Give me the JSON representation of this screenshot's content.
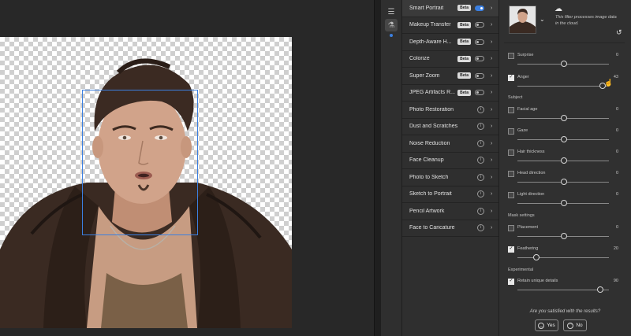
{
  "filters": [
    {
      "label": "Smart Portrait",
      "badge": "Beta",
      "control": "toggle",
      "on": true,
      "active": true
    },
    {
      "label": "Makeup Transfer",
      "badge": "Beta",
      "control": "toggle",
      "on": false
    },
    {
      "label": "Depth-Aware H...",
      "badge": "Beta",
      "control": "toggle",
      "on": false
    },
    {
      "label": "Colorize",
      "badge": "Beta",
      "control": "toggle",
      "on": false
    },
    {
      "label": "Super Zoom",
      "badge": "Beta",
      "control": "toggle",
      "on": false
    },
    {
      "label": "JPEG Artifacts R...",
      "badge": "Beta",
      "control": "toggle",
      "on": false
    },
    {
      "label": "Photo Restoration",
      "control": "info"
    },
    {
      "label": "Dust and Scratches",
      "control": "info"
    },
    {
      "label": "Noise Reduction",
      "control": "info"
    },
    {
      "label": "Face Cleanup",
      "control": "info"
    },
    {
      "label": "Photo to Sketch",
      "control": "info"
    },
    {
      "label": "Sketch to Portrait",
      "control": "info"
    },
    {
      "label": "Pencil Artwork",
      "control": "info"
    },
    {
      "label": "Face to Caricature",
      "control": "info"
    }
  ],
  "header": {
    "cloud_text": "This filter processes image data in the cloud.",
    "icons": [
      "cloud-icon",
      "undo-icon",
      "chevron-down-icon"
    ]
  },
  "sliders": {
    "surprise": {
      "label": "Surprise",
      "value": "0",
      "checked": false,
      "level": 0.5
    },
    "anger": {
      "label": "Anger",
      "value": "43",
      "checked": true,
      "level": 0.92
    },
    "facial_age": {
      "label": "Facial age",
      "value": "0",
      "checked": false,
      "level": 0.5
    },
    "gaze": {
      "label": "Gaze",
      "value": "0",
      "checked": false,
      "level": 0.5
    },
    "hair_thickness": {
      "label": "Hair thickness",
      "value": "0",
      "checked": false,
      "level": 0.5
    },
    "head_direction": {
      "label": "Head direction",
      "value": "0",
      "checked": false,
      "level": 0.5
    },
    "light_direction": {
      "label": "Light direction",
      "value": "0",
      "checked": false,
      "level": 0.5
    },
    "placement": {
      "label": "Placement",
      "value": "0",
      "checked": false,
      "level": 0.5
    },
    "feathering": {
      "label": "Feathering",
      "value": "20",
      "checked": true,
      "level": 0.2
    },
    "retain": {
      "label": "Retain unique details",
      "value": "90",
      "checked": true,
      "level": 0.9
    }
  },
  "sections": {
    "subject": "Subject",
    "mask": "Mask settings",
    "experimental": "Experimental"
  },
  "feedback": {
    "question": "Are you satisfied with the results?",
    "yes": "Yes",
    "no": "No"
  },
  "colors": {
    "accent": "#3b7fe0",
    "panel": "#303030",
    "canvas": "#282828"
  }
}
